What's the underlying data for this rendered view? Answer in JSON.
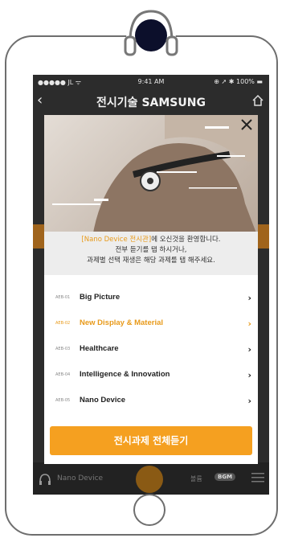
{
  "status": {
    "left": "●●●●● JL ᯤ",
    "time": "9:41 AM",
    "right": "⊕ ➚ ✱ 100% ▬"
  },
  "header": {
    "back": "‹",
    "title": "전시기술 SAMSUNG"
  },
  "modal": {
    "intro": {
      "highlight": "[Nano Device 전시관]",
      "line1_rest": "에 오신것을 환영합니다.",
      "line2": "전부 듣기를 탭 하시거나,",
      "line3": "과제별 선택 재생은 해당 과제를 탭 해주세요."
    },
    "items": [
      {
        "code": "AEB-01",
        "label": "Big Picture",
        "chev": "›"
      },
      {
        "code": "AEB-02",
        "label": "New Display & Material",
        "chev": "›"
      },
      {
        "code": "AEB-03",
        "label": "Healthcare",
        "chev": "›"
      },
      {
        "code": "AEB-04",
        "label": "Intelligence & Innovation",
        "chev": "›"
      },
      {
        "code": "AEB-05",
        "label": "Nano Device",
        "chev": "›"
      }
    ],
    "cta": "전시과제 전체듣기"
  },
  "footer": {
    "now_playing": "Nano Device",
    "volume": "볼륨",
    "bgm": "BGM"
  },
  "colors": {
    "accent": "#f5a020",
    "active_text": "#e89a1a"
  }
}
